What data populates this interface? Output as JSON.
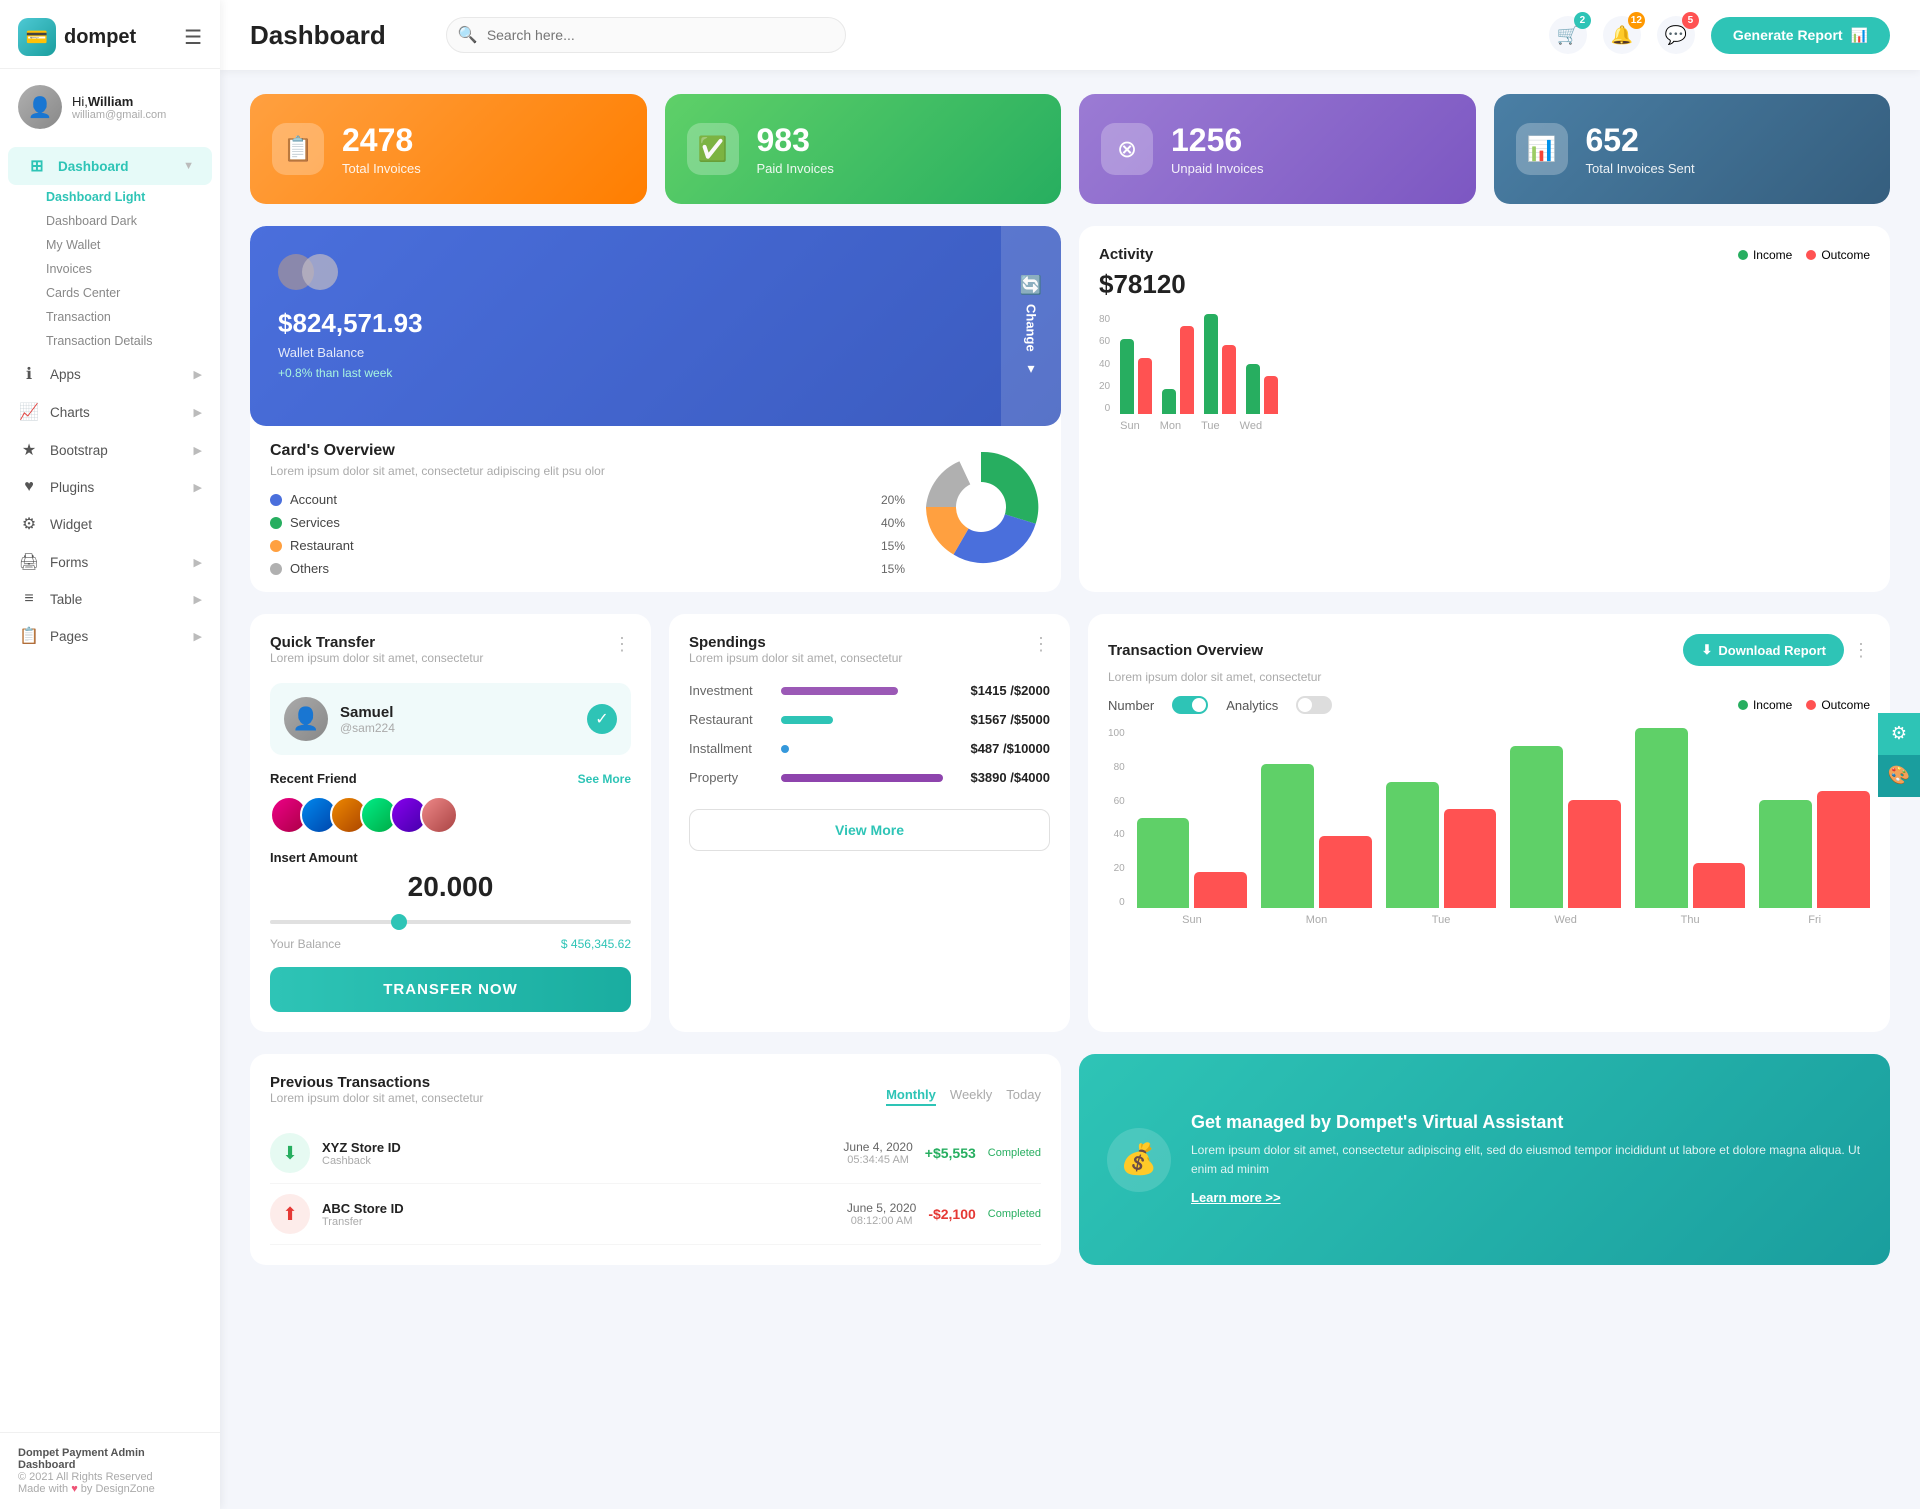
{
  "app": {
    "logo_text": "dompet",
    "logo_icon": "💳"
  },
  "header": {
    "title": "Dashboard",
    "search_placeholder": "Search here...",
    "generate_btn": "Generate Report",
    "badges": {
      "cart": "2",
      "bell": "12",
      "chat": "5"
    }
  },
  "sidebar": {
    "user": {
      "hi": "Hi,",
      "name": "William",
      "email": "william@gmail.com"
    },
    "nav": [
      {
        "id": "dashboard",
        "label": "Dashboard",
        "icon": "⊞",
        "active": true,
        "has_arrow": true
      },
      {
        "id": "apps",
        "label": "Apps",
        "icon": "ℹ",
        "active": false,
        "has_arrow": true
      },
      {
        "id": "charts",
        "label": "Charts",
        "icon": "📈",
        "active": false,
        "has_arrow": true
      },
      {
        "id": "bootstrap",
        "label": "Bootstrap",
        "icon": "★",
        "active": false,
        "has_arrow": true
      },
      {
        "id": "plugins",
        "label": "Plugins",
        "icon": "♥",
        "active": false,
        "has_arrow": true
      },
      {
        "id": "widget",
        "label": "Widget",
        "icon": "⚙",
        "active": false,
        "has_arrow": false
      },
      {
        "id": "forms",
        "label": "Forms",
        "icon": "🖨",
        "active": false,
        "has_arrow": true
      },
      {
        "id": "table",
        "label": "Table",
        "icon": "≡",
        "active": false,
        "has_arrow": true
      },
      {
        "id": "pages",
        "label": "Pages",
        "icon": "📋",
        "active": false,
        "has_arrow": true
      }
    ],
    "subnav": [
      {
        "label": "Dashboard Light",
        "active": true
      },
      {
        "label": "Dashboard Dark",
        "active": false
      },
      {
        "label": "My Wallet",
        "active": false
      },
      {
        "label": "Invoices",
        "active": false
      },
      {
        "label": "Cards Center",
        "active": false
      },
      {
        "label": "Transaction",
        "active": false
      },
      {
        "label": "Transaction Details",
        "active": false
      }
    ],
    "footer": {
      "brand": "Dompet Payment Admin Dashboard",
      "copy": "© 2021 All Rights Reserved",
      "made": "Made with",
      "by": "by DesignZone"
    }
  },
  "stat_cards": [
    {
      "id": "total-invoices",
      "num": "2478",
      "label": "Total Invoices",
      "color": "orange",
      "icon": "📋"
    },
    {
      "id": "paid-invoices",
      "num": "983",
      "label": "Paid Invoices",
      "color": "green",
      "icon": "✅"
    },
    {
      "id": "unpaid-invoices",
      "num": "1256",
      "label": "Unpaid Invoices",
      "color": "purple",
      "icon": "⊗"
    },
    {
      "id": "total-sent",
      "num": "652",
      "label": "Total Invoices Sent",
      "color": "blue-gray",
      "icon": "📊"
    }
  ],
  "wallet_card": {
    "amount": "$824,571.93",
    "label": "Wallet Balance",
    "change": "+0.8% than last week",
    "change_btn": "Change"
  },
  "cards_overview": {
    "title": "Card's Overview",
    "desc": "Lorem ipsum dolor sit amet, consectetur adipiscing elit psu olor",
    "legend": [
      {
        "label": "Account",
        "pct": "20%",
        "color": "#4a6fdc"
      },
      {
        "label": "Services",
        "pct": "40%",
        "color": "#27ae60"
      },
      {
        "label": "Restaurant",
        "pct": "15%",
        "color": "#ffa040"
      },
      {
        "label": "Others",
        "pct": "15%",
        "color": "#b0b0b0"
      }
    ]
  },
  "activity": {
    "title": "Activity",
    "amount": "$78120",
    "income_label": "Income",
    "outcome_label": "Outcome",
    "bars": [
      {
        "day": "Sun",
        "income": 60,
        "outcome": 45
      },
      {
        "day": "Mon",
        "income": 20,
        "outcome": 70
      },
      {
        "day": "Tue",
        "income": 80,
        "outcome": 55
      },
      {
        "day": "Wed",
        "income": 40,
        "outcome": 30
      }
    ]
  },
  "quick_transfer": {
    "title": "Quick Transfer",
    "desc": "Lorem ipsum dolor sit amet, consectetur",
    "recipient": {
      "name": "Samuel",
      "id": "@sam224"
    },
    "recent_label": "Recent Friend",
    "see_all": "See More",
    "insert_label": "Insert Amount",
    "amount": "20.000",
    "balance_label": "Your Balance",
    "balance": "$ 456,345.62",
    "transfer_btn": "TRANSFER NOW"
  },
  "spendings": {
    "title": "Spendings",
    "desc": "Lorem ipsum dolor sit amet, consectetur",
    "items": [
      {
        "label": "Investment",
        "amount": "$1415",
        "total": "$2000",
        "color": "#9b59b6",
        "pct": 70
      },
      {
        "label": "Restaurant",
        "amount": "$1567",
        "total": "$5000",
        "color": "#2ec4b6",
        "pct": 31
      },
      {
        "label": "Installment",
        "amount": "$487",
        "total": "$10000",
        "color": "#3498db",
        "pct": 5
      },
      {
        "label": "Property",
        "amount": "$3890",
        "total": "$4000",
        "color": "#8e44ad",
        "pct": 97
      }
    ],
    "view_more_btn": "View More"
  },
  "transaction_overview": {
    "title": "Transaction Overview",
    "desc": "Lorem ipsum dolor sit amet, consectetur",
    "download_btn": "Download Report",
    "number_label": "Number",
    "analytics_label": "Analytics",
    "income_label": "Income",
    "outcome_label": "Outcome",
    "bars": [
      {
        "day": "Sun",
        "income": 50,
        "outcome": 20
      },
      {
        "day": "Mon",
        "income": 80,
        "outcome": 40
      },
      {
        "day": "Tue",
        "income": 70,
        "outcome": 55
      },
      {
        "day": "Wed",
        "income": 90,
        "outcome": 60
      },
      {
        "day": "Thu",
        "income": 100,
        "outcome": 25
      },
      {
        "day": "Fri",
        "income": 60,
        "outcome": 65
      }
    ]
  },
  "prev_transactions": {
    "title": "Previous Transactions",
    "desc": "Lorem ipsum dolor sit amet, consectetur",
    "tabs": [
      "Monthly",
      "Weekly",
      "Today"
    ],
    "active_tab": "Monthly",
    "rows": [
      {
        "name": "XYZ Store ID",
        "type": "Cashback",
        "date": "June 4, 2020",
        "time": "05:34:45 AM",
        "amount": "+$5,553",
        "status": "Completed",
        "positive": true
      }
    ]
  },
  "virtual_assistant": {
    "title": "Get managed by Dompet's Virtual Assistant",
    "desc": "Lorem ipsum dolor sit amet, consectetur adipiscing elit, sed do eiusmod tempor incididunt ut labore et dolore magna aliqua. Ut enim ad minim",
    "link": "Learn more >>",
    "icon": "💰"
  }
}
